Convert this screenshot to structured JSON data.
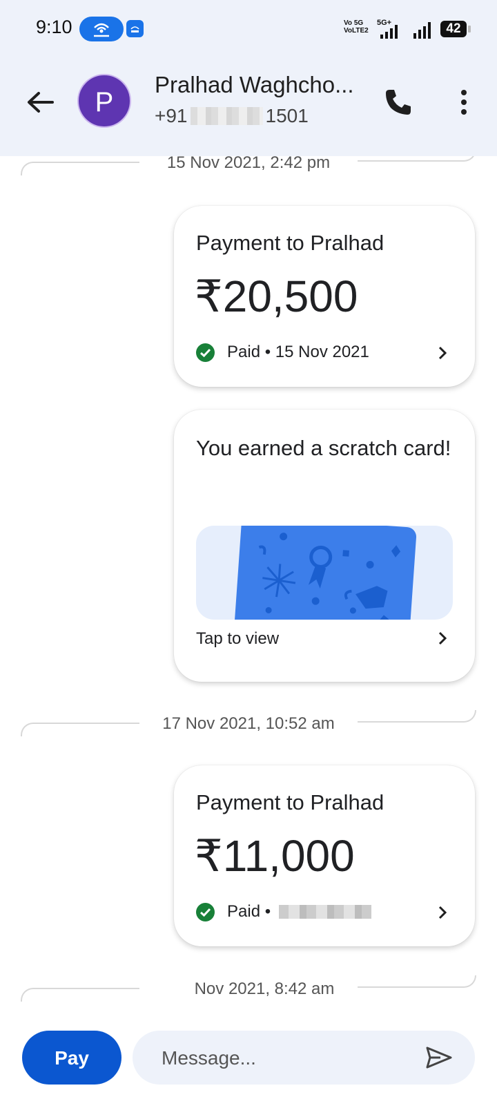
{
  "status_bar": {
    "time": "9:10",
    "volte": "Vo 5G\nVoLTE2",
    "network": "5G+",
    "battery": "42"
  },
  "header": {
    "avatar_letter": "P",
    "contact_name": "Pralhad Waghcho...",
    "phone_prefix": "+91",
    "phone_suffix": "1501"
  },
  "thread": [
    {
      "date": "15 Nov 2021, 2:42 pm"
    },
    {
      "card_title": "Payment to Pralhad",
      "amount": "₹20,500",
      "status": "Paid • 15 Nov 2021"
    },
    {
      "card_title": "You earned a scratch card!",
      "action": "Tap to view"
    },
    {
      "date": "17 Nov 2021, 10:52 am"
    },
    {
      "card_title": "Payment to Pralhad",
      "amount": "₹11,000",
      "status": "Paid •"
    },
    {
      "date": "Nov 2021, 8:42 am"
    }
  ],
  "composer": {
    "pay_label": "Pay",
    "message_placeholder": "Message..."
  },
  "colors": {
    "accent": "#0b57d0",
    "avatar": "#5e35b1",
    "paid_green": "#188038",
    "header_bg": "#eef2fa"
  }
}
